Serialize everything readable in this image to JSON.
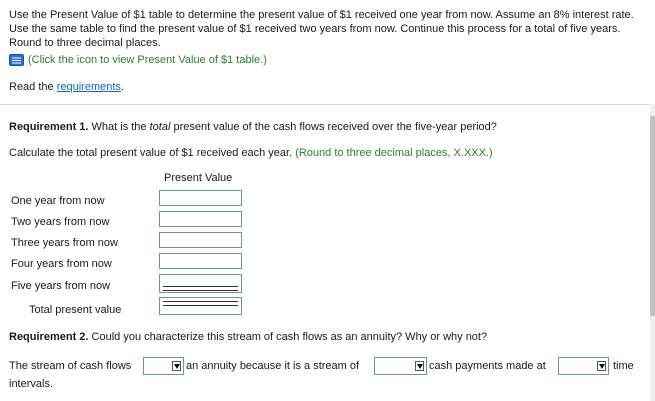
{
  "instructions": "Use the Present Value of $1 table to determine the present value of $1 received one year from now. Assume an 8% interest rate. Use the same table to find the present value of $1 received two years from now. Continue this process for a total of five years. Round to three decimal places.",
  "table_hint": "(Click the icon to view Present Value of $1 table.)",
  "read_prefix": "Read the ",
  "requirements_link": "requirements",
  "read_suffix": ".",
  "req1": {
    "label": "Requirement 1.",
    "q_before": " What is the ",
    "q_italic": "total",
    "q_after": " present value of the cash flows received over the five-year period?"
  },
  "calc": {
    "text": "Calculate the total present value of $1 received each year. ",
    "hint": "(Round to three decimal places, X.XXX.)"
  },
  "pv_header": "Present Value",
  "rows": [
    {
      "label": "One year from now",
      "value": ""
    },
    {
      "label": "Two years from now",
      "value": ""
    },
    {
      "label": "Three years from now",
      "value": ""
    },
    {
      "label": "Four years from now",
      "value": ""
    },
    {
      "label": "Five years from now",
      "value": ""
    }
  ],
  "total_label": "Total present value",
  "total_value": "",
  "req2": {
    "label": "Requirement 2.",
    "question": " Could you characterize this stream of cash flows as an annuity? Why or why not?"
  },
  "annuity": {
    "part1": "The stream of cash flows",
    "part2": "an annuity because it is a stream of",
    "part3": "cash payments made at",
    "part4": "time",
    "part5": "intervals.",
    "dropdown1": "",
    "dropdown2": "",
    "dropdown3": ""
  },
  "colors": {
    "hint_green": "#2e7d32",
    "link_blue": "#1565c0",
    "input_border": "#6f8dbf"
  }
}
